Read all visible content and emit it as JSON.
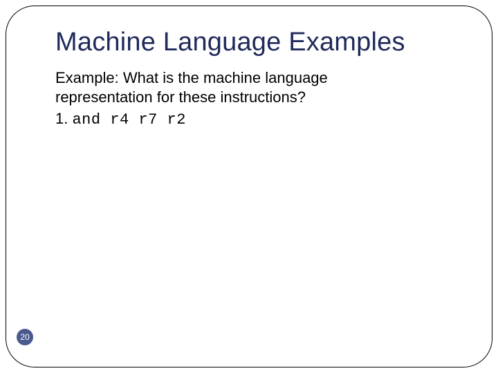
{
  "slide": {
    "title": "Machine Language Examples",
    "body": {
      "line1": "Example: What is the machine language",
      "line2": "representation for these instructions?"
    },
    "list": {
      "item1": {
        "num": "1.",
        "code": "and r4 r7 r2"
      }
    },
    "page_number": "20"
  }
}
